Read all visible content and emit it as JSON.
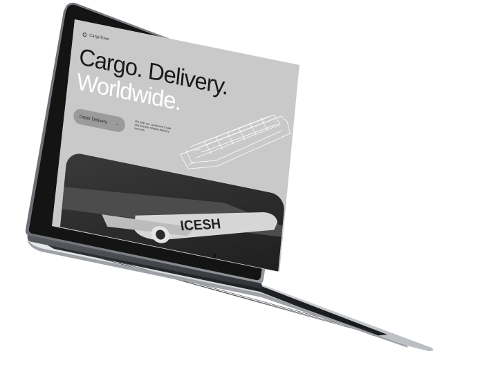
{
  "site": {
    "brand": "CargoTown",
    "headline_line1": "Cargo. Delivery.",
    "headline_line2": "Worldwide.",
    "cta_label": "Order Delivery",
    "cta_icon": "arrow-right-icon",
    "tagline": "We help our customers to get and provide reliable delivery services."
  },
  "colors": {
    "screen_bg": "#c9c9c9",
    "headline_dark": "#1a1a1a",
    "headline_light": "#ffffff",
    "button_bg": "#9b9b9b",
    "photo_bg": "#2b2b2b",
    "laptop_bezel": "#141414",
    "laptop_body": "#c8cacd"
  }
}
